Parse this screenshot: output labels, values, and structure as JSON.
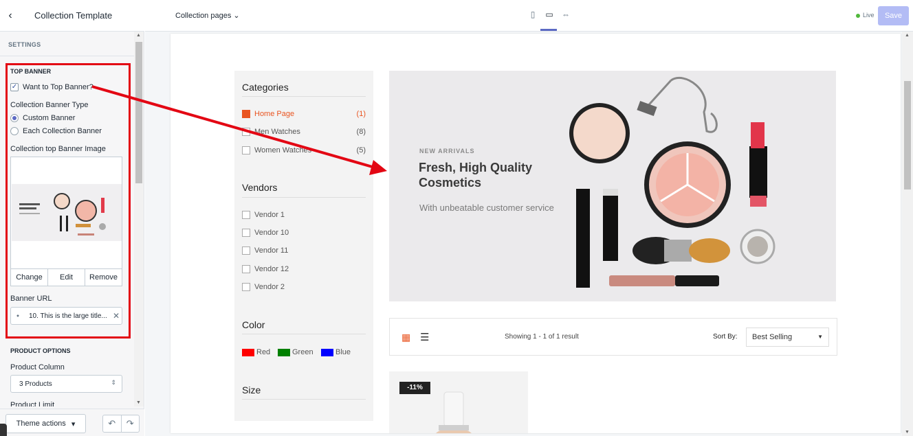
{
  "header": {
    "title": "Collection Template",
    "pages_dropdown": "Collection pages",
    "live_label": "Live",
    "save_label": "Save"
  },
  "settings": {
    "section_label": "SETTINGS",
    "top_banner": {
      "title": "TOP BANNER",
      "want_top_banner": "Want to Top Banner?",
      "want_top_banner_checked": true,
      "banner_type_label": "Collection Banner Type",
      "banner_type_options": [
        "Custom Banner",
        "Each Collection Banner"
      ],
      "banner_type_selected": "Custom Banner",
      "image_label": "Collection top Banner Image",
      "image_buttons": [
        "Change",
        "Edit",
        "Remove"
      ],
      "url_label": "Banner URL",
      "url_value": "10. This is the large title..."
    },
    "product_options": {
      "title": "PRODUCT OPTIONS",
      "column_label": "Product Column",
      "column_value": "3 Products",
      "limit_label": "Product Limit"
    },
    "theme_actions": "Theme actions"
  },
  "store": {
    "categories_title": "Categories",
    "categories": [
      {
        "label": "Home Page",
        "count": "(1)",
        "active": true
      },
      {
        "label": "Men Watches",
        "count": "(8)",
        "active": false
      },
      {
        "label": "Women Watches",
        "count": "(5)",
        "active": false
      }
    ],
    "vendors_title": "Vendors",
    "vendors": [
      "Vendor 1",
      "Vendor 10",
      "Vendor 11",
      "Vendor 12",
      "Vendor 2"
    ],
    "color_title": "Color",
    "colors": [
      {
        "label": "Red",
        "hex": "#ff0000"
      },
      {
        "label": "Green",
        "hex": "#008000"
      },
      {
        "label": "Blue",
        "hex": "#0000ff"
      }
    ],
    "size_title": "Size",
    "banner": {
      "kicker": "NEW ARRIVALS",
      "title": "Fresh, High Quality Cosmetics",
      "subtitle": "With unbeatable customer service"
    },
    "toolbar": {
      "showing": "Showing 1 - 1 of 1 result",
      "sort_label": "Sort By:",
      "sort_value": "Best Selling"
    },
    "product_badge": "-11%"
  },
  "colors": {
    "accent": "#e95420",
    "annotation": "#e30613",
    "primary_button": "#b3bcf5",
    "live_dot": "#50b83c"
  }
}
